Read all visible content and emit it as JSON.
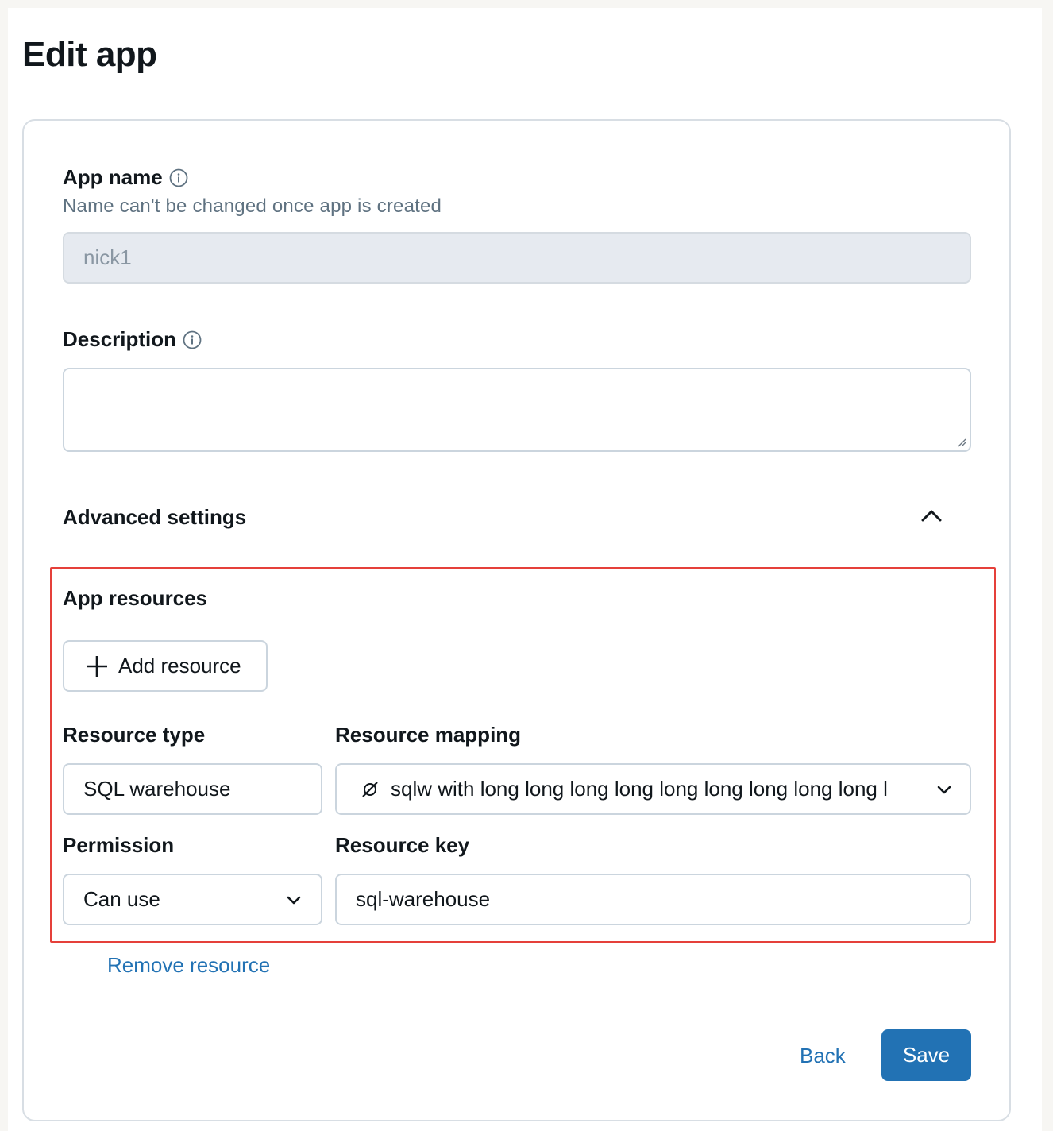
{
  "page": {
    "title": "Edit app"
  },
  "form": {
    "app_name": {
      "label": "App name",
      "hint": "Name can't be changed once app is created",
      "value": "nick1"
    },
    "description": {
      "label": "Description",
      "value": ""
    },
    "advanced_settings": {
      "label": "Advanced settings",
      "expanded": true
    },
    "app_resources": {
      "label": "App resources",
      "add_button_label": "Add resource",
      "resource_type": {
        "label": "Resource type",
        "value": "SQL warehouse"
      },
      "resource_mapping": {
        "label": "Resource mapping",
        "value": "sqlw with long long long long long long long long long l"
      },
      "permission": {
        "label": "Permission",
        "value": "Can use"
      },
      "resource_key": {
        "label": "Resource key",
        "value": "sql-warehouse"
      },
      "remove_link": "Remove resource"
    }
  },
  "footer": {
    "back_label": "Back",
    "save_label": "Save"
  },
  "colors": {
    "primary": "#2272b4",
    "highlight_border": "#e5403a"
  },
  "icons": [
    "info-icon",
    "chevron-up-icon",
    "plus-icon",
    "unlink-icon",
    "chevron-down-icon",
    "resize-grip-icon"
  ]
}
